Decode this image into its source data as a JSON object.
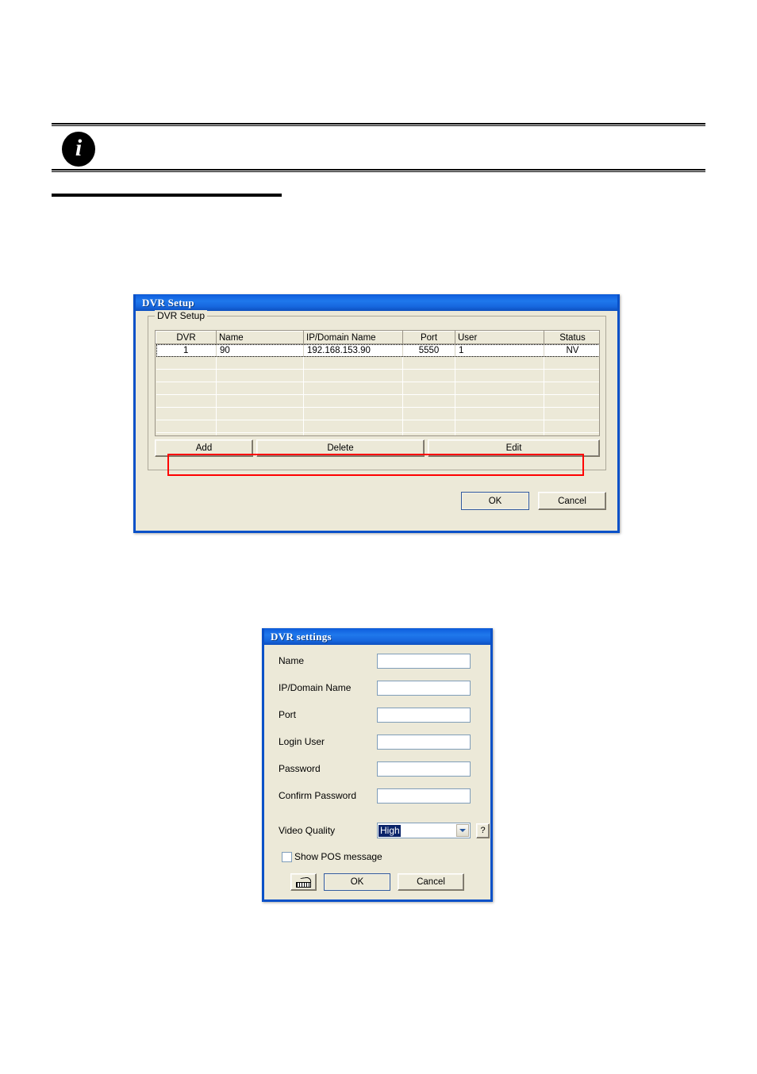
{
  "note": {
    "icon": "info-icon",
    "icon_letter": "i"
  },
  "dvr_setup_dialog": {
    "title": "DVR Setup",
    "groupbox_label": "DVR Setup",
    "table": {
      "columns": [
        "DVR",
        "Name",
        "IP/Domain Name",
        "Port",
        "User",
        "Status"
      ],
      "rows": [
        {
          "dvr": "1",
          "name": "90",
          "ip_domain_name": "192.168.153.90",
          "port": "5550",
          "user": "1",
          "status": "NV"
        }
      ],
      "empty_row_count": 7
    },
    "buttons": {
      "add": "Add",
      "delete": "Delete",
      "edit": "Edit",
      "ok": "OK",
      "cancel": "Cancel"
    },
    "highlight_color": "#ff0000"
  },
  "dvr_settings_dialog": {
    "title": "DVR settings",
    "fields": [
      {
        "label": "Name",
        "value": ""
      },
      {
        "label": "IP/Domain Name",
        "value": ""
      },
      {
        "label": "Port",
        "value": ""
      },
      {
        "label": "Login User",
        "value": ""
      },
      {
        "label": "Password",
        "value": ""
      },
      {
        "label": "Confirm Password",
        "value": ""
      }
    ],
    "video_quality": {
      "label": "Video Quality",
      "selected": "High",
      "help_label": "?"
    },
    "show_pos_message": {
      "label": "Show POS message",
      "checked": false
    },
    "buttons": {
      "keyboard_icon": "on-screen-keyboard-icon",
      "ok": "OK",
      "cancel": "Cancel"
    }
  },
  "colors": {
    "title_bar_blue": "#1f78ec",
    "dialog_face": "#ece9d8",
    "selection_blue": "#0a246a",
    "annotation_red": "#ff0000"
  }
}
